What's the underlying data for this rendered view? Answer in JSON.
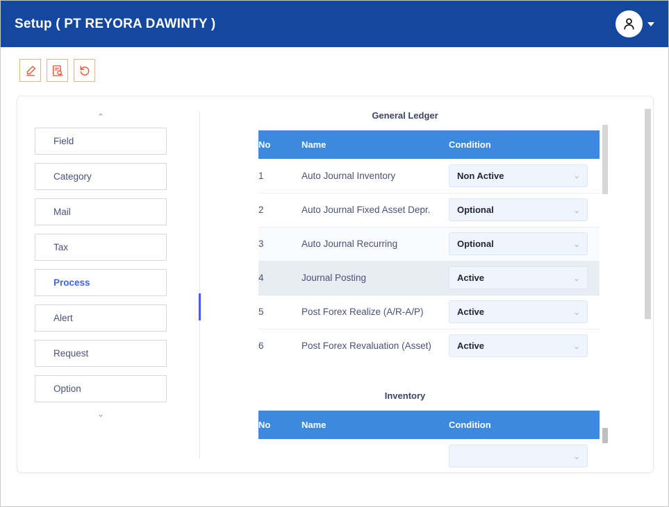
{
  "header": {
    "title": "Setup ( PT REYORA DAWINTY )",
    "avatar_icon": "user-person-icon",
    "caret_icon": "caret-down-icon"
  },
  "toolbar": {
    "buttons": [
      {
        "name": "edit",
        "icon": "pencil-edit-icon",
        "label": "Edit"
      },
      {
        "name": "view",
        "icon": "document-search-icon",
        "label": "View"
      },
      {
        "name": "refresh",
        "icon": "refresh-undo-icon",
        "label": "Refresh"
      }
    ]
  },
  "sidebar": {
    "scroll_up_icon": "chevron-up-icon",
    "scroll_down_icon": "chevron-down-icon",
    "scroll_up_glyph": "⌃",
    "scroll_down_glyph": "⌄",
    "active_item": "Process",
    "items": [
      {
        "label": "Field",
        "active": false
      },
      {
        "label": "Category",
        "active": false
      },
      {
        "label": "Mail",
        "active": false
      },
      {
        "label": "Tax",
        "active": false
      },
      {
        "label": "Process",
        "active": true
      },
      {
        "label": "Alert",
        "active": false
      },
      {
        "label": "Request",
        "active": false
      },
      {
        "label": "Option",
        "active": false
      }
    ]
  },
  "content": {
    "sections": [
      {
        "title": "General Ledger",
        "columns": {
          "no": "No",
          "name": "Name",
          "condition": "Condition"
        },
        "rows": [
          {
            "no": "1",
            "name": "Auto Journal Inventory",
            "condition": "Non Active",
            "state": "plain"
          },
          {
            "no": "2",
            "name": "Auto Journal Fixed Asset Depr.",
            "condition": "Optional",
            "state": "plain"
          },
          {
            "no": "3",
            "name": "Auto Journal Recurring",
            "condition": "Optional",
            "state": "alt"
          },
          {
            "no": "4",
            "name": "Journal Posting",
            "condition": "Active",
            "state": "hover"
          },
          {
            "no": "5",
            "name": "Post Forex Realize (A/R-A/P)",
            "condition": "Active",
            "state": "plain"
          },
          {
            "no": "6",
            "name": "Post Forex Revaluation (Asset)",
            "condition": "Active",
            "state": "plain"
          }
        ]
      },
      {
        "title": "Inventory",
        "columns": {
          "no": "No",
          "name": "Name",
          "condition": "Condition"
        },
        "rows": [
          {
            "no": "",
            "name": "",
            "condition": "",
            "state": "plain"
          }
        ]
      }
    ],
    "select_chevron_glyph": "⌄",
    "select_chevron_icon": "chevron-down-icon"
  },
  "colors": {
    "header_blue": "#14479e",
    "table_header_blue": "#3b8ae0",
    "accent_blue": "#3e63f0",
    "icon_orange": "#e8532b",
    "select_bg": "#eff5fd",
    "row_hover": "#e8edf3"
  }
}
